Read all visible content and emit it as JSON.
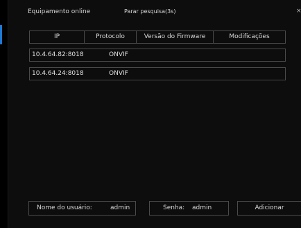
{
  "dialog": {
    "title": "Equipamento online",
    "stop_search": "Parar pesquisa(3s)",
    "close_symbol": "×"
  },
  "table": {
    "headers": [
      "IP",
      "Protocolo",
      "Versão do Firmware",
      "Modificações"
    ],
    "rows": [
      {
        "ip": "10.4.64.82:8018",
        "protocol": "ONVIF",
        "firmware": "",
        "modifications": ""
      },
      {
        "ip": "10.4.64.24:8018",
        "protocol": "ONVIF",
        "firmware": "",
        "modifications": ""
      }
    ]
  },
  "footer": {
    "username_label": "Nome do usuário:",
    "username_value": "admin",
    "password_label": "Senha:",
    "password_value": "admin",
    "add_label": "Adicionar"
  },
  "colors": {
    "background": "#000000",
    "panel": "#0d0d0d",
    "border": "#4a4a4a",
    "text": "#d8d8d8",
    "accent": "#1f78d1"
  }
}
